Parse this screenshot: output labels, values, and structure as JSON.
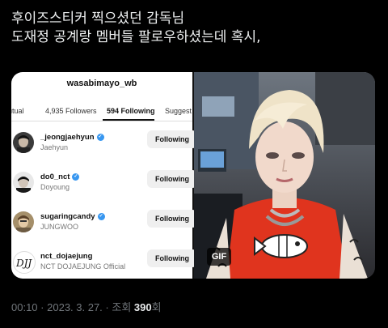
{
  "tweet": {
    "line1": "후이즈스티커 찍으셨던 감독님",
    "line2": "도재정 공계랑 멤버들 팔로우하셨는데 혹시,"
  },
  "screenshot": {
    "username": "wasabimayo_wb",
    "tabs": [
      "utual",
      "4,935 Followers",
      "594 Following",
      "Suggest"
    ],
    "active_tab": "594 Following",
    "rows": [
      {
        "handle": "_jeongjaehyun",
        "name": "Jaehyun",
        "verified": true,
        "button": "Following"
      },
      {
        "handle": "do0_nct",
        "name": "Doyoung",
        "verified": true,
        "button": "Following"
      },
      {
        "handle": "sugaringcandy",
        "name": "JUNGWOO",
        "verified": true,
        "button": "Following"
      },
      {
        "handle": "nct_dojaejung",
        "name": "NCT DOJAEJUNG Official",
        "verified": false,
        "button": "Following"
      }
    ],
    "logo_text": "DJJ"
  },
  "gif": {
    "badge": "GIF"
  },
  "meta": {
    "time": "00:10",
    "date": "2023. 3. 27.",
    "views_label": "조회",
    "views_count": "390",
    "views_suffix": "회"
  },
  "colors": {
    "verified": "#3897f0",
    "shirt": "#e0341e",
    "hair": "#efe3c8"
  }
}
